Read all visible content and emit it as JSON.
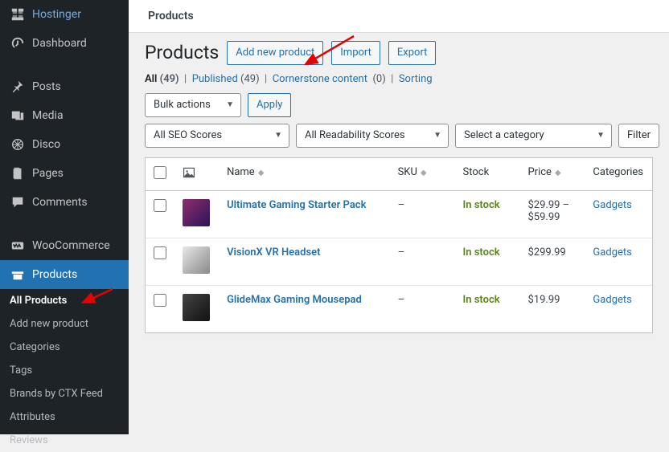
{
  "sidebar": {
    "items": [
      {
        "label": "Hostinger"
      },
      {
        "label": "Dashboard"
      },
      {
        "label": "Posts"
      },
      {
        "label": "Media"
      },
      {
        "label": "Disco"
      },
      {
        "label": "Pages"
      },
      {
        "label": "Comments"
      },
      {
        "label": "WooCommerce"
      },
      {
        "label": "Products"
      }
    ],
    "submenu": [
      {
        "label": "All Products"
      },
      {
        "label": "Add new product"
      },
      {
        "label": "Categories"
      },
      {
        "label": "Tags"
      },
      {
        "label": "Brands by CTX Feed"
      },
      {
        "label": "Attributes"
      },
      {
        "label": "Reviews"
      }
    ]
  },
  "topbar": {
    "title": "Products"
  },
  "header": {
    "title": "Products",
    "add_btn": "Add new product",
    "import_btn": "Import",
    "export_btn": "Export"
  },
  "subsubsub": {
    "all": "All",
    "all_count": "(49)",
    "published": "Published",
    "published_count": "(49)",
    "cornerstone": "Cornerstone content",
    "cornerstone_count": "(0)",
    "sorting": "Sorting"
  },
  "filters": {
    "bulk": "Bulk actions",
    "apply": "Apply",
    "seo": "All SEO Scores",
    "readability": "All Readability Scores",
    "category": "Select a category",
    "filter": "Filter"
  },
  "columns": {
    "name": "Name",
    "sku": "SKU",
    "stock": "Stock",
    "price": "Price",
    "categories": "Categories"
  },
  "products": [
    {
      "name": "Ultimate Gaming Starter Pack",
      "sku": "–",
      "stock": "In stock",
      "price": "$29.99 – $59.99",
      "category": "Gadgets"
    },
    {
      "name": "VisionX VR Headset",
      "sku": "–",
      "stock": "In stock",
      "price": "$299.99",
      "category": "Gadgets"
    },
    {
      "name": "GlideMax Gaming Mousepad",
      "sku": "–",
      "stock": "In stock",
      "price": "$19.99",
      "category": "Gadgets"
    }
  ]
}
